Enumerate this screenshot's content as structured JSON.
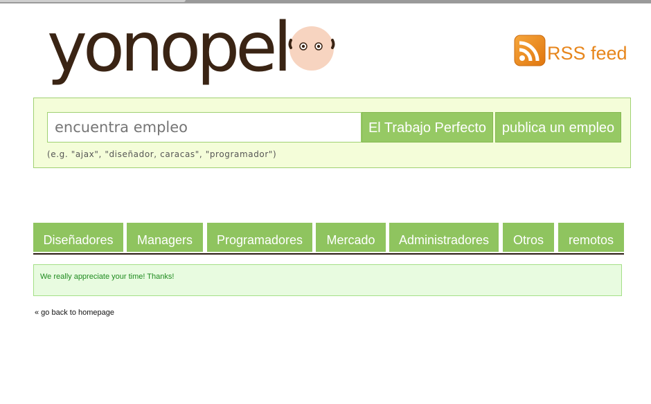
{
  "logo": {
    "text": "yonopel"
  },
  "rss": {
    "label": "RSS feed",
    "icon": "rss-icon",
    "color": "#e7861c"
  },
  "search": {
    "placeholder": "encuentra empleo",
    "find_button": "El Trabajo Perfecto",
    "post_button": "publica un empleo",
    "hint": "(e.g. \"ajax\", \"diseñador, caracas\", \"programador\")"
  },
  "nav": {
    "tabs": [
      {
        "label": "Diseñadores"
      },
      {
        "label": "Managers"
      },
      {
        "label": "Programadores"
      },
      {
        "label": "Mercado"
      },
      {
        "label": "Administradores"
      },
      {
        "label": "Otros"
      },
      {
        "label": "remotos"
      }
    ]
  },
  "message": {
    "text": "We really appreciate your time! Thanks!"
  },
  "back_link": {
    "label": "« go back to homepage"
  },
  "colors": {
    "accent_green": "#8fc45f",
    "panel_bg": "#f4fdd9",
    "logo_brown": "#3a2414"
  }
}
